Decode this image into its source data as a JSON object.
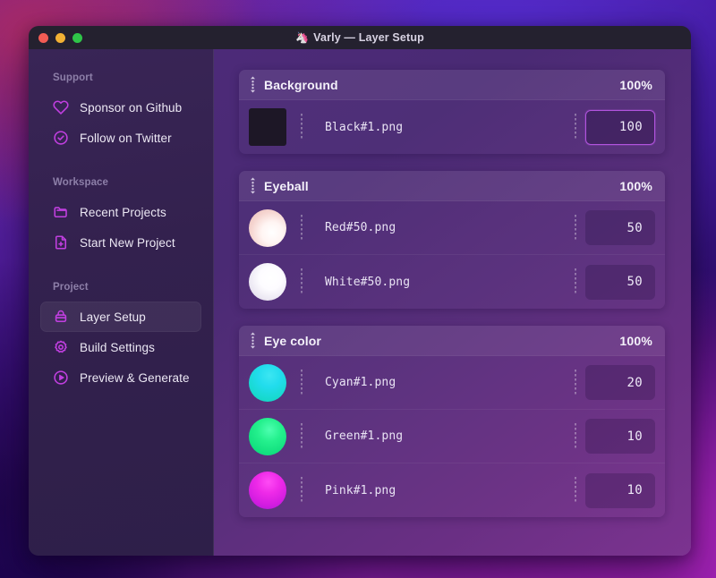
{
  "window": {
    "title": "Varly — Layer Setup",
    "title_emoji": "🦄",
    "traffic_lights": [
      "close",
      "minimize",
      "zoom"
    ]
  },
  "sidebar": {
    "sections": [
      {
        "label": "Support",
        "items": [
          {
            "label": "Sponsor on Github",
            "icon": "heart-icon",
            "active": false
          },
          {
            "label": "Follow on Twitter",
            "icon": "check-circle-icon",
            "active": false
          }
        ]
      },
      {
        "label": "Workspace",
        "items": [
          {
            "label": "Recent Projects",
            "icon": "folder-icon",
            "active": false
          },
          {
            "label": "Start New Project",
            "icon": "file-plus-icon",
            "active": false
          }
        ]
      },
      {
        "label": "Project",
        "items": [
          {
            "label": "Layer Setup",
            "icon": "layers-icon",
            "active": true
          },
          {
            "label": "Build Settings",
            "icon": "gear-icon",
            "active": false
          },
          {
            "label": "Preview & Generate",
            "icon": "play-circle-icon",
            "active": false
          }
        ]
      }
    ]
  },
  "main": {
    "groups": [
      {
        "name": "Background",
        "percent": "100%",
        "layers": [
          {
            "name": "Black#1.png",
            "value": "100",
            "focused": true,
            "thumb": "square-black"
          }
        ]
      },
      {
        "name": "Eyeball",
        "percent": "100%",
        "layers": [
          {
            "name": "Red#50.png",
            "value": "50",
            "focused": false,
            "thumb": "sphere-red"
          },
          {
            "name": "White#50.png",
            "value": "50",
            "focused": false,
            "thumb": "sphere-white"
          }
        ]
      },
      {
        "name": "Eye color",
        "percent": "100%",
        "layers": [
          {
            "name": "Cyan#1.png",
            "value": "20",
            "focused": false,
            "thumb": "sphere-cyan"
          },
          {
            "name": "Green#1.png",
            "value": "10",
            "focused": false,
            "thumb": "sphere-green"
          },
          {
            "name": "Pink#1.png",
            "value": "10",
            "focused": false,
            "thumb": "sphere-pink"
          }
        ]
      }
    ]
  },
  "colors": {
    "accent": "#c13fe0",
    "focus_border": "#b254de",
    "titlebar": "#24212f",
    "sidebar": "#33214e",
    "traffic_red": "#f25c54",
    "traffic_yellow": "#f2b134",
    "traffic_green": "#2fc548",
    "thumb_black": "#1d1726",
    "thumb_cyan": "#22e0e0",
    "thumb_green": "#22e88a",
    "thumb_pink": "#e030e8"
  }
}
